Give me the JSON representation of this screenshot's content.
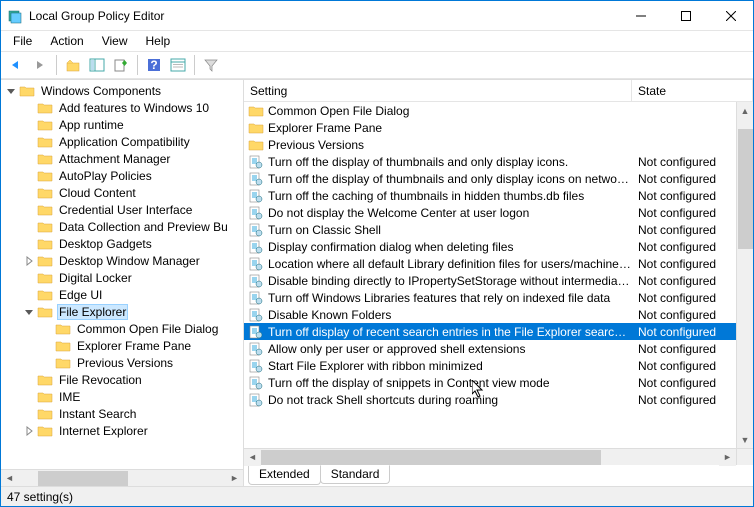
{
  "window": {
    "title": "Local Group Policy Editor"
  },
  "menubar": [
    "File",
    "Action",
    "View",
    "Help"
  ],
  "tree": [
    {
      "indent": 0,
      "twisty": "down",
      "label": "Windows Components",
      "type": "folder"
    },
    {
      "indent": 1,
      "twisty": "",
      "label": "Add features to Windows 10",
      "type": "folder"
    },
    {
      "indent": 1,
      "twisty": "",
      "label": "App runtime",
      "type": "folder"
    },
    {
      "indent": 1,
      "twisty": "",
      "label": "Application Compatibility",
      "type": "folder"
    },
    {
      "indent": 1,
      "twisty": "",
      "label": "Attachment Manager",
      "type": "folder"
    },
    {
      "indent": 1,
      "twisty": "",
      "label": "AutoPlay Policies",
      "type": "folder"
    },
    {
      "indent": 1,
      "twisty": "",
      "label": "Cloud Content",
      "type": "folder"
    },
    {
      "indent": 1,
      "twisty": "",
      "label": "Credential User Interface",
      "type": "folder"
    },
    {
      "indent": 1,
      "twisty": "",
      "label": "Data Collection and Preview Bu",
      "type": "folder"
    },
    {
      "indent": 1,
      "twisty": "",
      "label": "Desktop Gadgets",
      "type": "folder"
    },
    {
      "indent": 1,
      "twisty": "right",
      "label": "Desktop Window Manager",
      "type": "folder"
    },
    {
      "indent": 1,
      "twisty": "",
      "label": "Digital Locker",
      "type": "folder"
    },
    {
      "indent": 1,
      "twisty": "",
      "label": "Edge UI",
      "type": "folder"
    },
    {
      "indent": 1,
      "twisty": "down",
      "label": "File Explorer",
      "type": "folder",
      "selected": true
    },
    {
      "indent": 2,
      "twisty": "",
      "label": "Common Open File Dialog",
      "type": "folder"
    },
    {
      "indent": 2,
      "twisty": "",
      "label": "Explorer Frame Pane",
      "type": "folder"
    },
    {
      "indent": 2,
      "twisty": "",
      "label": "Previous Versions",
      "type": "folder"
    },
    {
      "indent": 1,
      "twisty": "",
      "label": "File Revocation",
      "type": "folder"
    },
    {
      "indent": 1,
      "twisty": "",
      "label": "IME",
      "type": "folder"
    },
    {
      "indent": 1,
      "twisty": "",
      "label": "Instant Search",
      "type": "folder"
    },
    {
      "indent": 1,
      "twisty": "right",
      "label": "Internet Explorer",
      "type": "folder"
    }
  ],
  "columns": {
    "setting": "Setting",
    "state": "State"
  },
  "rows": [
    {
      "type": "folder",
      "setting": "Common Open File Dialog",
      "state": ""
    },
    {
      "type": "folder",
      "setting": "Explorer Frame Pane",
      "state": ""
    },
    {
      "type": "folder",
      "setting": "Previous Versions",
      "state": ""
    },
    {
      "type": "policy",
      "setting": "Turn off the display of thumbnails and only display icons.",
      "state": "Not configured"
    },
    {
      "type": "policy",
      "setting": "Turn off the display of thumbnails and only display icons on network ...",
      "state": "Not configured"
    },
    {
      "type": "policy",
      "setting": "Turn off the caching of thumbnails in hidden thumbs.db files",
      "state": "Not configured"
    },
    {
      "type": "policy",
      "setting": "Do not display the Welcome Center at user logon",
      "state": "Not configured"
    },
    {
      "type": "policy",
      "setting": "Turn on Classic Shell",
      "state": "Not configured"
    },
    {
      "type": "policy",
      "setting": "Display confirmation dialog when deleting files",
      "state": "Not configured"
    },
    {
      "type": "policy",
      "setting": "Location where all default Library definition files for users/machines r...",
      "state": "Not configured"
    },
    {
      "type": "policy",
      "setting": "Disable binding directly to IPropertySetStorage without intermediate l...",
      "state": "Not configured"
    },
    {
      "type": "policy",
      "setting": "Turn off Windows Libraries features that rely on indexed file data",
      "state": "Not configured"
    },
    {
      "type": "policy",
      "setting": "Disable Known Folders",
      "state": "Not configured"
    },
    {
      "type": "policy",
      "setting": "Turn off display of recent search entries in the File Explorer search box",
      "state": "Not configured",
      "selected": true
    },
    {
      "type": "policy",
      "setting": "Allow only per user or approved shell extensions",
      "state": "Not configured"
    },
    {
      "type": "policy",
      "setting": "Start File Explorer with ribbon minimized",
      "state": "Not configured"
    },
    {
      "type": "policy",
      "setting": "Turn off the display of snippets in Content view mode",
      "state": "Not configured"
    },
    {
      "type": "policy",
      "setting": "Do not track Shell shortcuts during roaming",
      "state": "Not configured"
    }
  ],
  "tabs": {
    "extended": "Extended",
    "standard": "Standard"
  },
  "statusbar": {
    "text": "47 setting(s)"
  }
}
